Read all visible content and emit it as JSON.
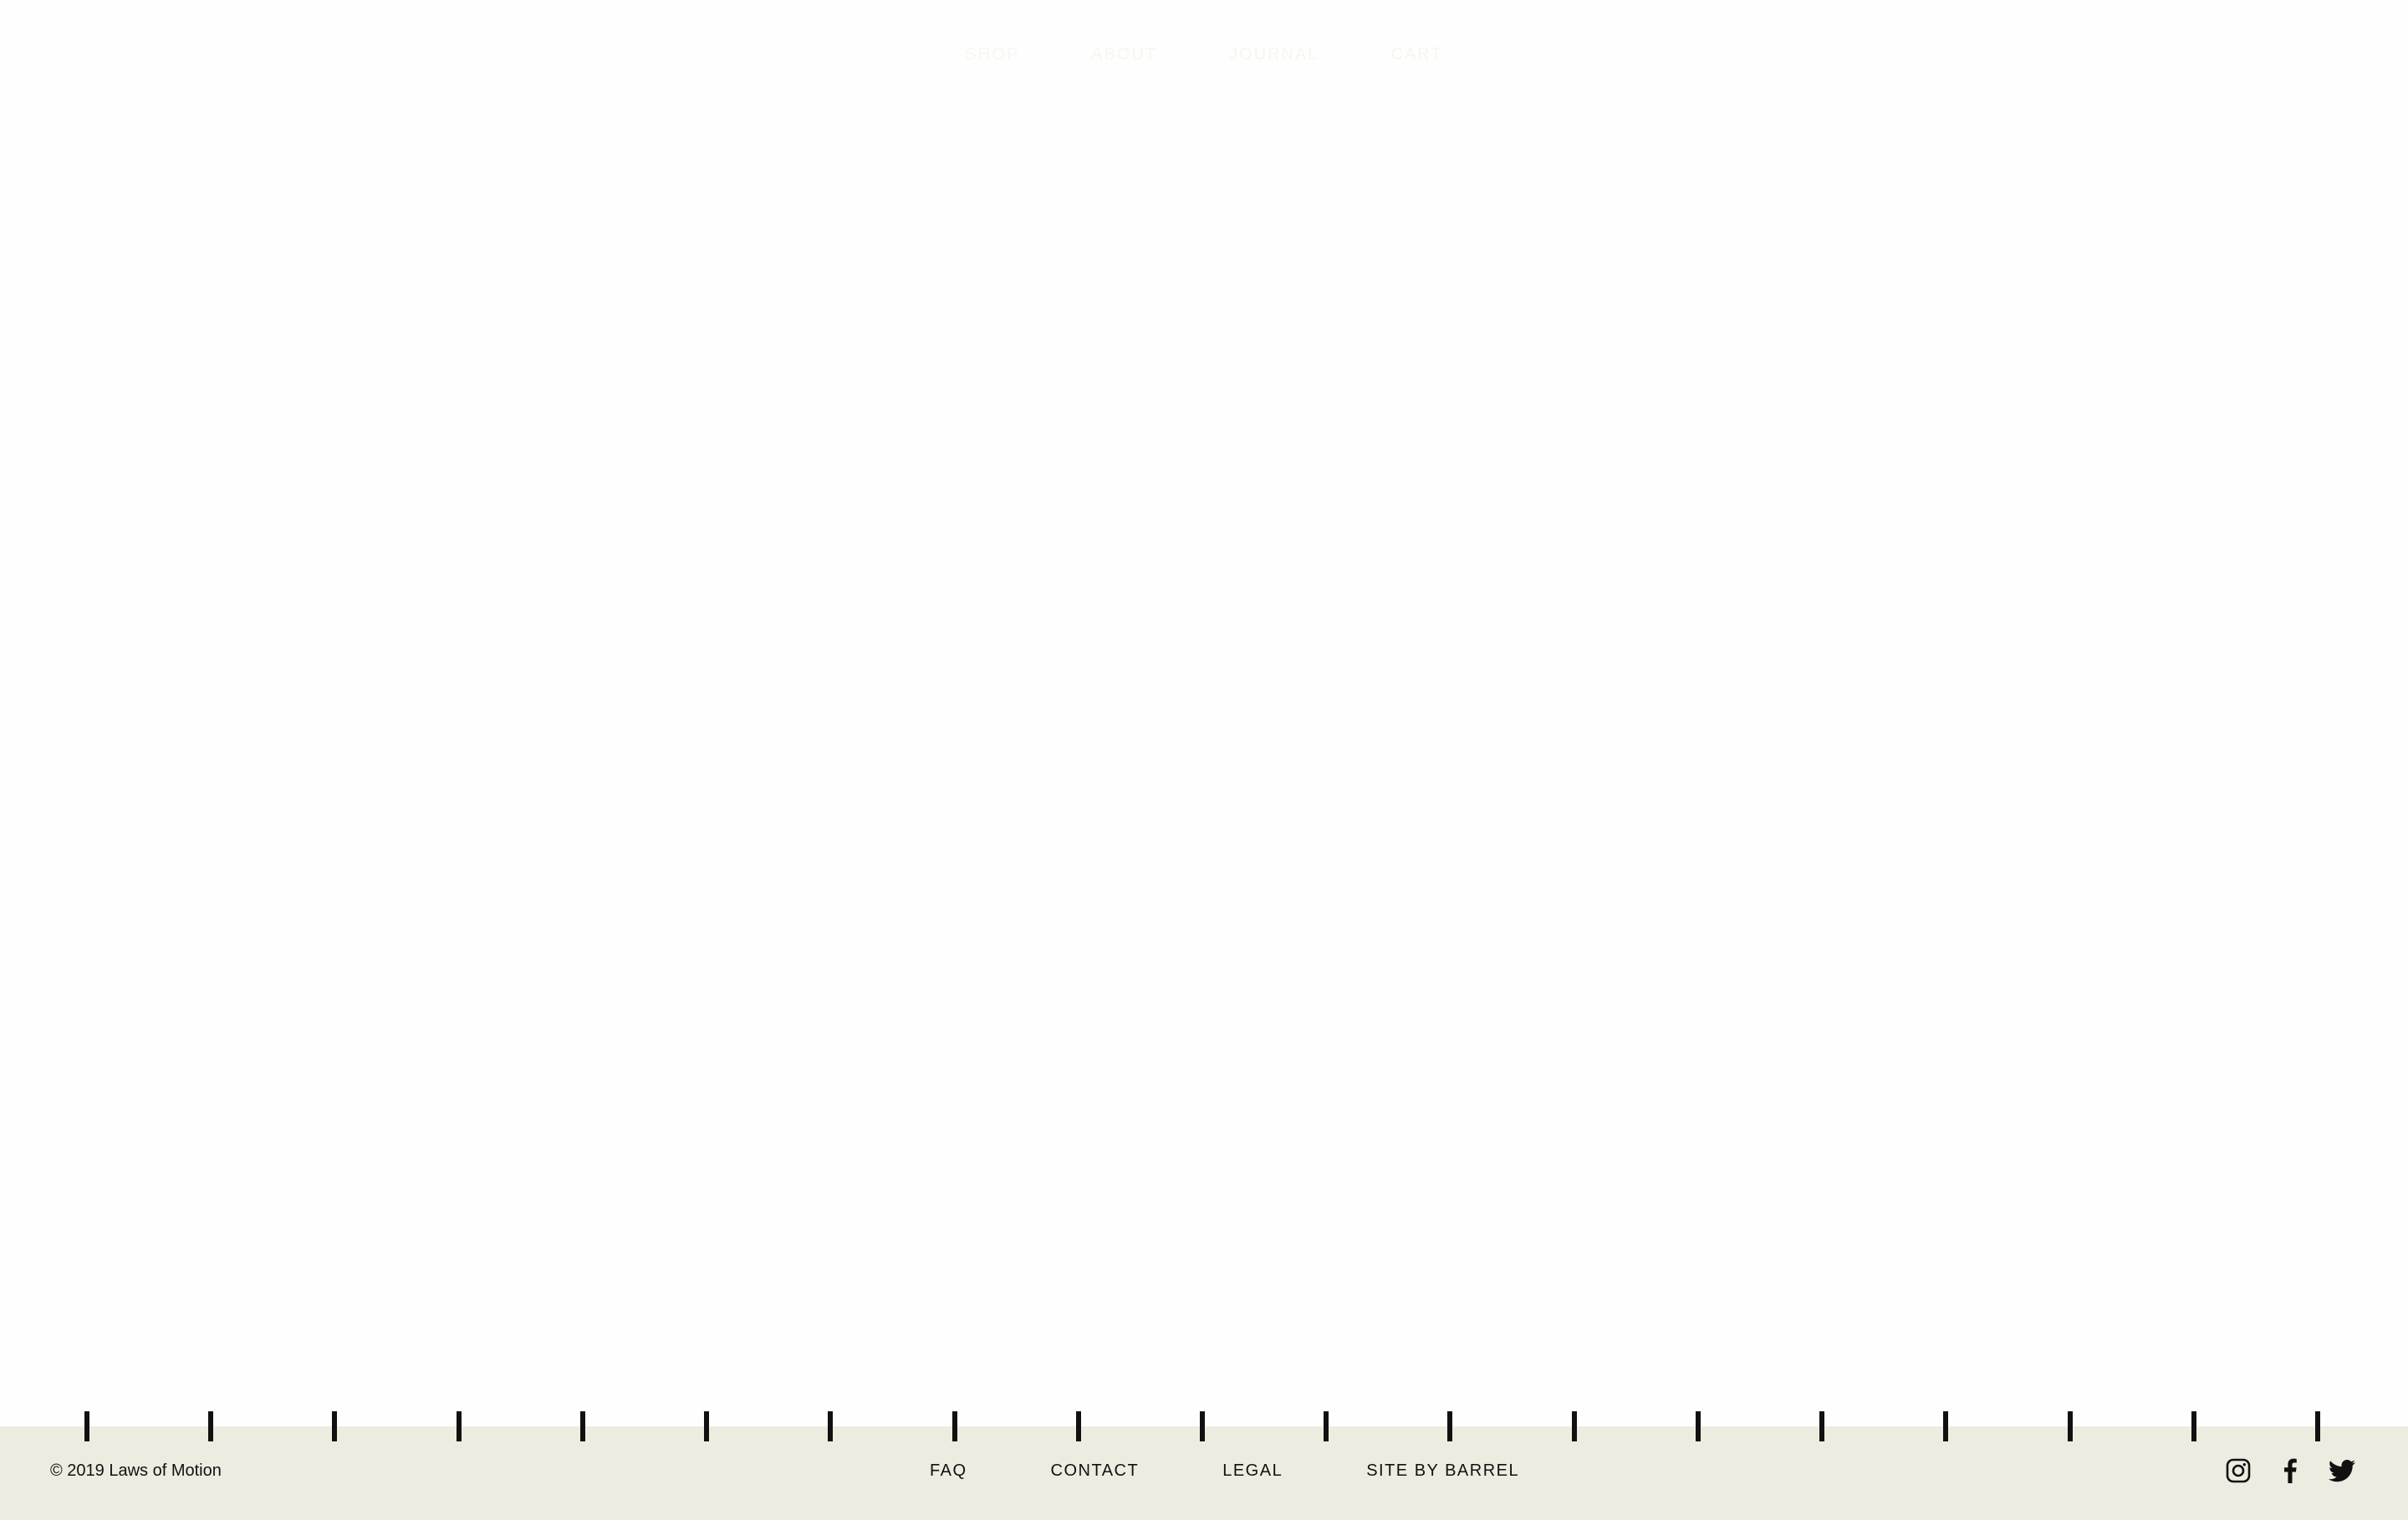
{
  "top_nav": {
    "items": [
      "SHOP",
      "ABOUT",
      "JOURNAL",
      "CART"
    ]
  },
  "ruler": {
    "tick_count": 19,
    "tick_color": "#111111"
  },
  "footer": {
    "background": "#eeebe0",
    "copyright": "© 2019 Laws of Motion",
    "links": {
      "faq": "FAQ",
      "contact": "CONTACT",
      "legal": "LEGAL",
      "site_by": "SITE BY BARREL"
    },
    "social": [
      {
        "icon": "instagram-icon"
      },
      {
        "icon": "facebook-icon"
      },
      {
        "icon": "twitter-icon"
      }
    ]
  }
}
